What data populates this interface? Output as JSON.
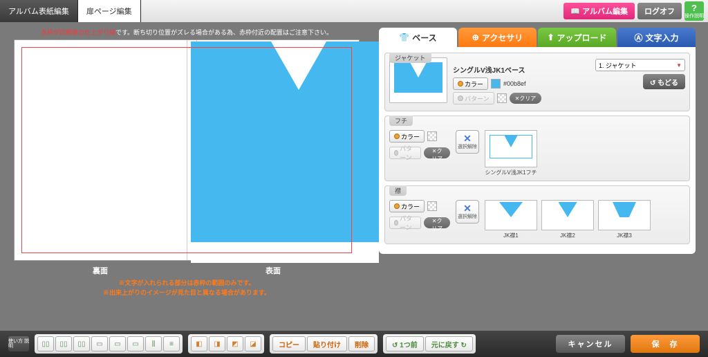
{
  "header": {
    "tabs": [
      "アルバム表紙編集",
      "扉ページ編集"
    ],
    "active_tab": 1,
    "album_edit": "アルバム編集",
    "logoff": "ログオフ",
    "help_label": "操作説明"
  },
  "canvas": {
    "warn_top_red": "赤枠が印刷後の仕上がり線",
    "warn_top_rest": "です。断ち切り位置がズレる場合がある為、赤枠付近の配置はご注意下さい。",
    "back_label": "裏面",
    "front_label": "表面",
    "warn_bot_1": "※文字が入れられる部分は赤枠の範囲のみです。",
    "warn_bot_2": "※出来上がりのイメージが見た目と異なる場合があります。"
  },
  "panel": {
    "tabs": {
      "base": "ベース",
      "accessory": "アクセサリ",
      "upload": "アップロード",
      "text": "文字入力"
    },
    "jacket": {
      "label": "ジャケット",
      "title": "シングルV浅JK1ベース",
      "color_btn": "カラー",
      "pattern_btn": "パターン",
      "color_code": "#00b8ef",
      "clear": "クリア",
      "dropdown": "1. ジャケット",
      "back": "もどる"
    },
    "fuchi": {
      "label": "フチ",
      "color_btn": "カラー",
      "pattern_btn": "パターン",
      "clear": "クリア",
      "unselect": "選択解除",
      "option1": "シングルV浅JK1フチ"
    },
    "eri": {
      "label": "襟",
      "color_btn": "カラー",
      "pattern_btn": "パターン",
      "clear": "クリア",
      "unselect": "選択解除",
      "options": [
        "JK襟1",
        "JK襟2",
        "JK襟3"
      ]
    }
  },
  "footer": {
    "usage": "使い方\n説明",
    "copy": "コピー",
    "paste": "貼り付け",
    "delete": "削除",
    "undo": "1つ前",
    "redo": "元に戻す",
    "cancel": "キャンセル",
    "save": "保　存"
  },
  "colors": {
    "accent": "#44b8ef"
  }
}
